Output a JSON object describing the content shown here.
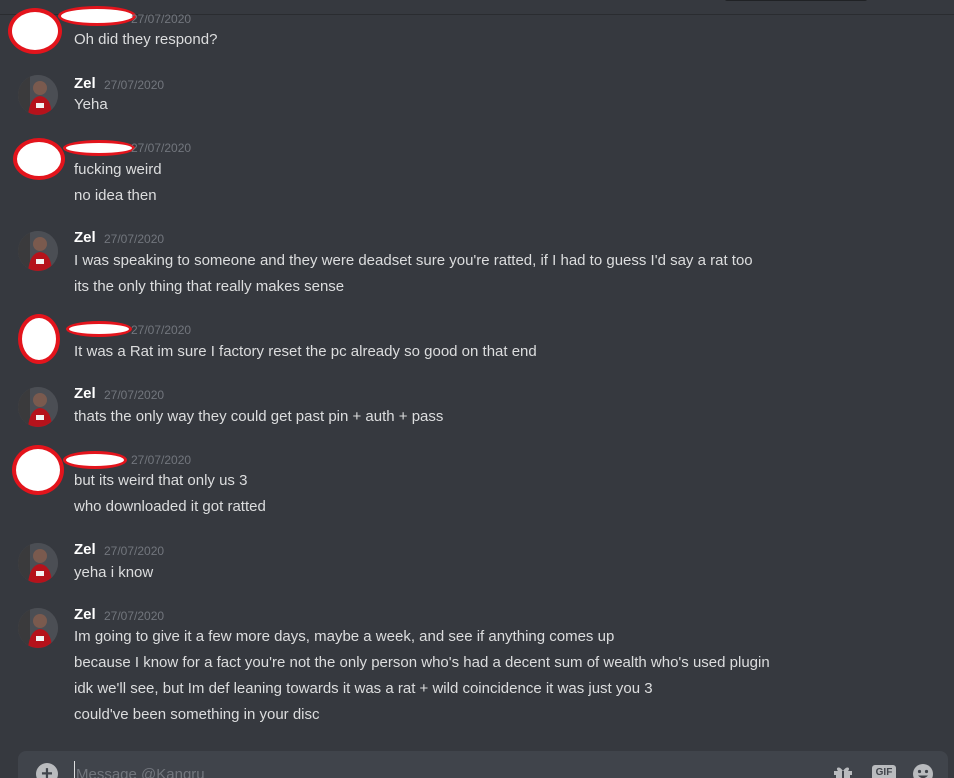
{
  "composer": {
    "placeholder": "Message @Kangru",
    "gif_label": "GIF"
  },
  "messages": [
    {
      "author": "",
      "redacted_author": true,
      "timestamp": "27/07/2020",
      "lines": [
        "Oh did they respond?"
      ]
    },
    {
      "author": "Zel",
      "timestamp": "27/07/2020",
      "lines": [
        "Yeha"
      ]
    },
    {
      "author": "",
      "redacted_author": true,
      "timestamp": "27/07/2020",
      "lines": [
        "fucking weird",
        "no idea then"
      ]
    },
    {
      "author": "Zel",
      "timestamp": "27/07/2020",
      "lines": [
        "I was speaking to someone and they were deadset sure you're ratted, if I had to guess I'd say a rat too",
        "its the only thing that really makes sense"
      ]
    },
    {
      "author": "",
      "redacted_author": true,
      "timestamp": "27/07/2020",
      "lines": [
        "It was a Rat im sure I factory reset the pc already so good on that end"
      ]
    },
    {
      "author": "Zel",
      "timestamp": "27/07/2020",
      "lines": [
        "thats the only way they could get past pin + auth + pass"
      ]
    },
    {
      "author": "",
      "redacted_author": true,
      "timestamp": "27/07/2020",
      "lines": [
        "but its weird that only us 3",
        "who downloaded it got ratted"
      ]
    },
    {
      "author": "Zel",
      "timestamp": "27/07/2020",
      "lines": [
        "yeha i know"
      ]
    },
    {
      "author": "Zel",
      "timestamp": "27/07/2020",
      "lines": [
        "Im going to give it a few more days, maybe a week,  and see if anything comes up",
        "because I know for a fact you're not the only person who's had a decent sum of wealth who's used plugin",
        "idk we'll see, but Im def leaning towards it was a rat + wild coincidence it was just you 3",
        "could've been something in your disc"
      ]
    }
  ],
  "colors": {
    "background": "#36393f",
    "composer": "#40444b",
    "username": "#ffffff",
    "text": "#dcddde",
    "timestamp": "#72767d",
    "redaction_red": "#e3141c"
  },
  "icons": [
    "plus-circle-icon",
    "gift-icon",
    "gif-icon",
    "emoji-icon",
    "avatar-zel"
  ]
}
